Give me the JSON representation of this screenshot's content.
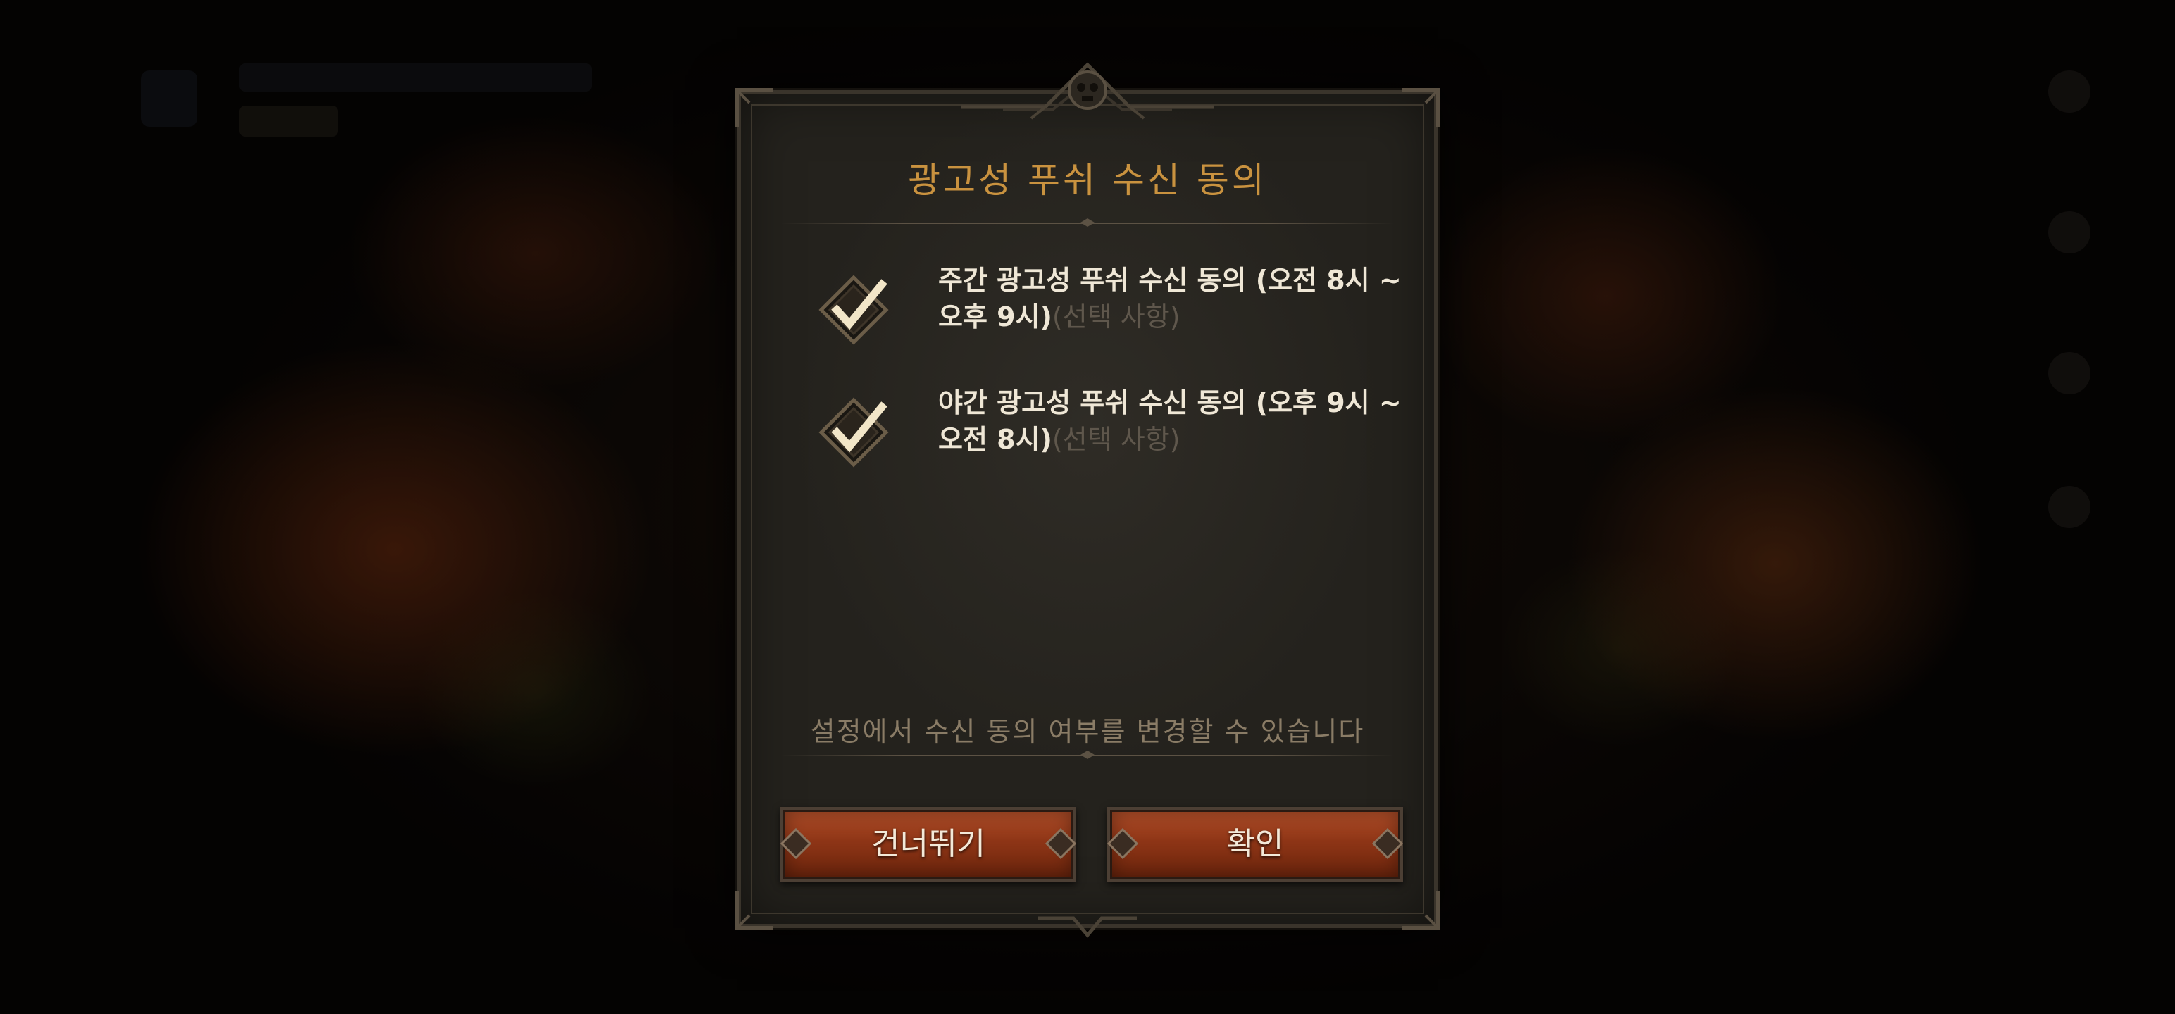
{
  "dialog": {
    "title": "광고성 푸쉬 수신 동의",
    "options": [
      {
        "label": "주간 광고성 푸쉬 수신 동의 (오전 8시 ~오후 9시)",
        "note": "(선택 사항)",
        "checked": true
      },
      {
        "label": "야간 광고성 푸쉬 수신 동의 (오후 9시 ~오전 8시)",
        "note": "(선택 사항)",
        "checked": true
      }
    ],
    "footer_note": "설정에서 수신 동의 여부를 변경할 수 있습니다",
    "buttons": {
      "skip_label": "건너뛰기",
      "confirm_label": "확인"
    }
  },
  "colors": {
    "title": "#c9923f",
    "button": "#8e3516",
    "checkmark": "#f2e6c8",
    "panel": "#2f2c26"
  },
  "icons": {
    "checkbox": "checked-diamond-checkbox-icon",
    "ornament": "skull-ornament-icon"
  }
}
